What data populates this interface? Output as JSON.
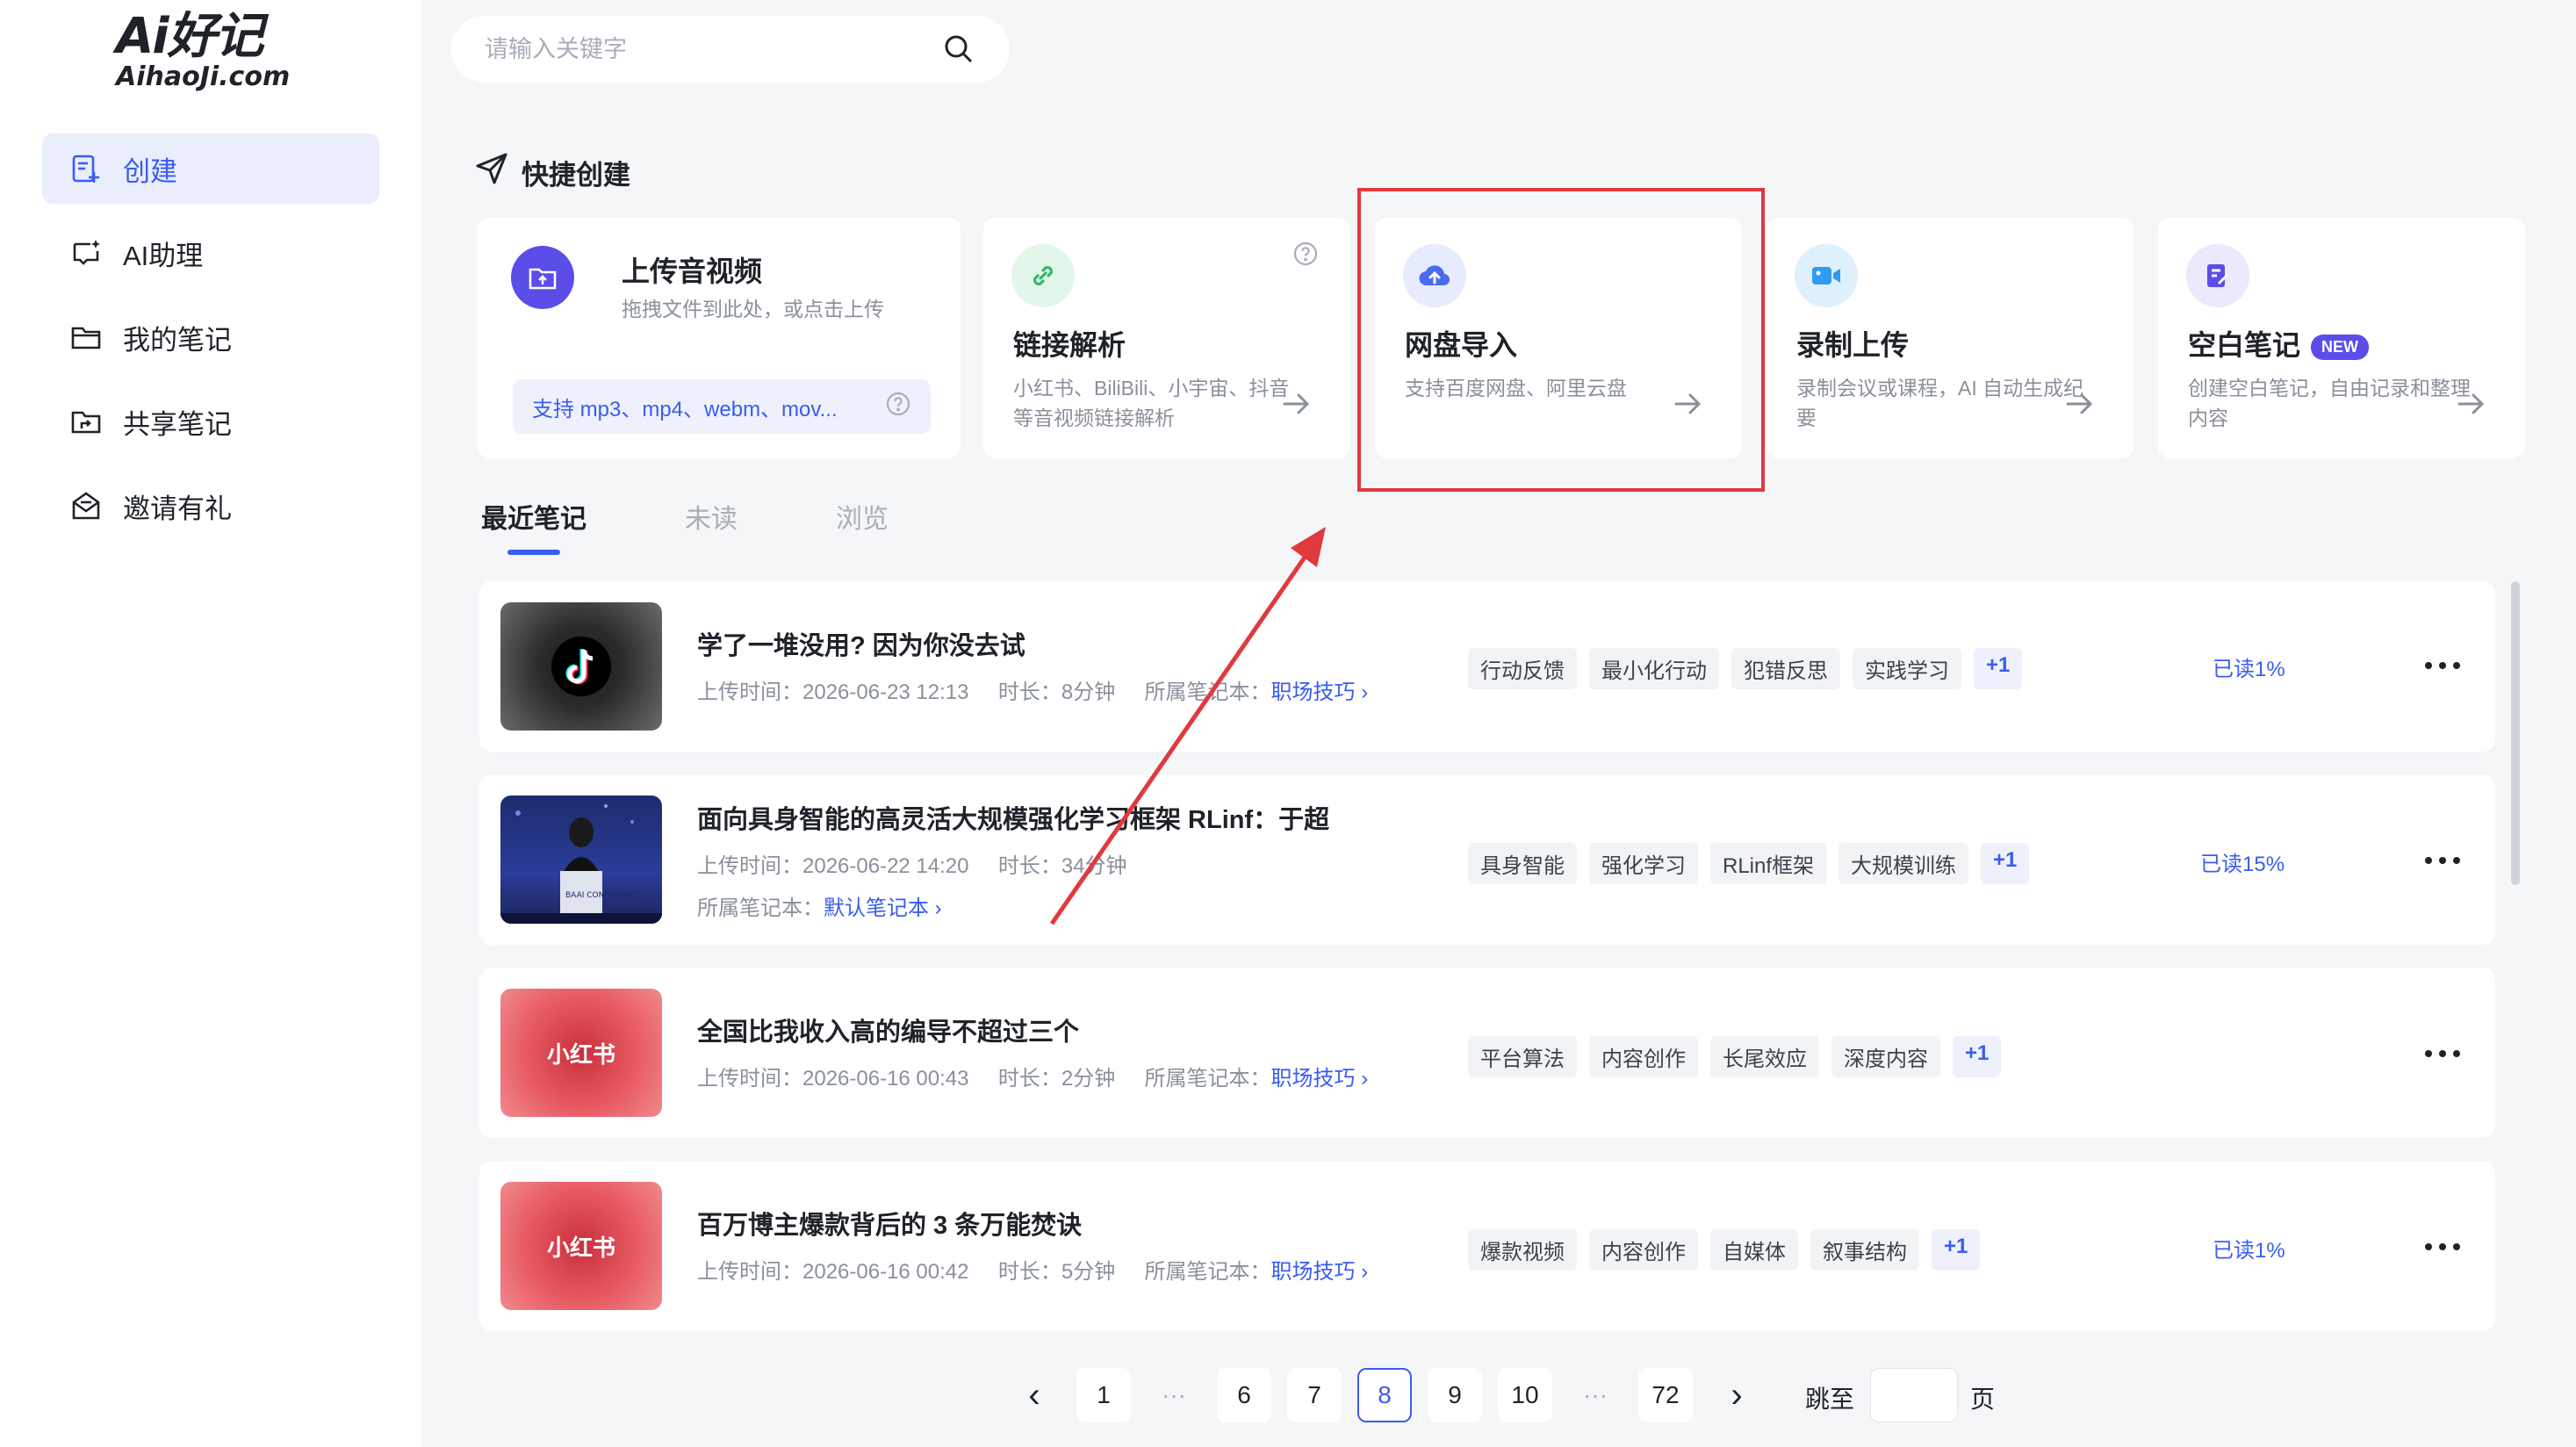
{
  "logo": {
    "top": "Ai好记",
    "bottom": "AihaoJi.com"
  },
  "sidebar": {
    "items": [
      {
        "label": "创建",
        "icon": "create-note-icon",
        "active": true
      },
      {
        "label": "AI助理",
        "icon": "chat-sparkle-icon",
        "active": false
      },
      {
        "label": "我的笔记",
        "icon": "folder-icon",
        "active": false
      },
      {
        "label": "共享笔记",
        "icon": "shared-folder-icon",
        "active": false
      },
      {
        "label": "邀请有礼",
        "icon": "mail-gift-icon",
        "active": false
      }
    ]
  },
  "search": {
    "placeholder": "请输入关键字",
    "value": ""
  },
  "quick_create": {
    "title": "快捷创建",
    "upload": {
      "title": "上传音视频",
      "desc": "拖拽文件到此处，或点击上传",
      "formats": "支持 mp3、mp4、webm、mov..."
    },
    "link": {
      "title": "链接解析",
      "desc_line1": "小红书、BiliBili、小宇宙、抖音",
      "desc_line2": "等音视频链接解析"
    },
    "cloud": {
      "title": "网盘导入",
      "desc": "支持百度网盘、阿里云盘"
    },
    "record": {
      "title": "录制上传",
      "desc_line1": "录制会议或课程，AI 自动生成纪",
      "desc_line2": "要"
    },
    "blank": {
      "title": "空白笔记",
      "badge": "NEW",
      "desc_line1": "创建空白笔记，自由记录和整理",
      "desc_line2": "内容"
    }
  },
  "tabs": [
    {
      "label": "最近笔记",
      "active": true
    },
    {
      "label": "未读",
      "active": false
    },
    {
      "label": "浏览",
      "active": false
    }
  ],
  "notes": [
    {
      "title": "学了一堆没用? 因为你没去试",
      "upload_label": "上传时间：",
      "upload_time": "2026-06-23 12:13",
      "duration_label": "时长：",
      "duration": "8分钟",
      "notebook_label": "所属笔记本：",
      "notebook": "职场技巧 ›",
      "tags": [
        "行动反馈",
        "最小化行动",
        "犯错反思",
        "实践学习"
      ],
      "more_tags": "+1",
      "read": "已读1%",
      "thumb": "tiktok"
    },
    {
      "title": "面向具身智能的高灵活大规模强化学习框架 RLinf：于超",
      "upload_label": "上传时间：",
      "upload_time": "2026-06-22 14:20",
      "duration_label": "时长：",
      "duration": "34分钟",
      "notebook_label": "所属笔记本：",
      "notebook": "默认笔记本 ›",
      "tags": [
        "具身智能",
        "强化学习",
        "RLinf框架",
        "大规模训练"
      ],
      "more_tags": "+1",
      "read": "已读15%",
      "thumb": "video",
      "thumb_caption": "BAAI CONFERENCE"
    },
    {
      "title": "全国比我收入高的编导不超过三个",
      "upload_label": "上传时间：",
      "upload_time": "2026-06-16 00:43",
      "duration_label": "时长：",
      "duration": "2分钟",
      "notebook_label": "所属笔记本：",
      "notebook": "职场技巧 ›",
      "tags": [
        "平台算法",
        "内容创作",
        "长尾效应",
        "深度内容"
      ],
      "more_tags": "+1",
      "read": "",
      "thumb": "xhs",
      "thumb_label": "小红书"
    },
    {
      "title": "百万博主爆款背后的 3 条万能焚诀",
      "upload_label": "上传时间：",
      "upload_time": "2026-06-16 00:42",
      "duration_label": "时长：",
      "duration": "5分钟",
      "notebook_label": "所属笔记本：",
      "notebook": "职场技巧 ›",
      "tags": [
        "爆款视频",
        "内容创作",
        "自媒体",
        "叙事结构"
      ],
      "more_tags": "+1",
      "read": "已读1%",
      "thumb": "xhs",
      "thumb_label": "小红书"
    }
  ],
  "pagination": {
    "prev": "‹",
    "next": "›",
    "pages": [
      "1",
      "6",
      "7",
      "8",
      "9",
      "10",
      "72"
    ],
    "current": "8",
    "ellipsis": "···",
    "jump_prefix": "跳至",
    "jump_suffix": "页",
    "jump_value": ""
  },
  "colors": {
    "accent": "#3a5cf0",
    "highlight": "#e0393e",
    "sidebar_active_bg": "#e9edfc"
  }
}
